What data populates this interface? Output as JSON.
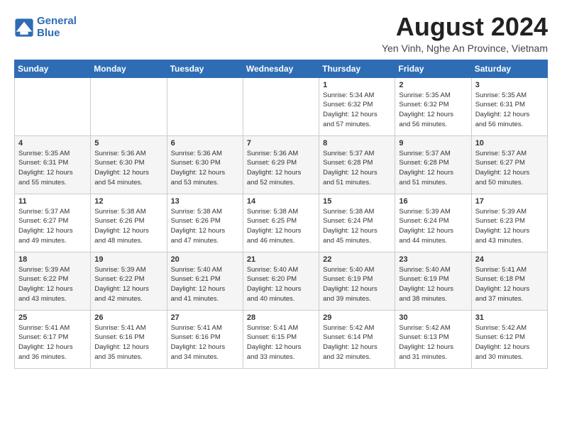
{
  "logo": {
    "line1": "General",
    "line2": "Blue"
  },
  "title": "August 2024",
  "subtitle": "Yen Vinh, Nghe An Province, Vietnam",
  "weekdays": [
    "Sunday",
    "Monday",
    "Tuesday",
    "Wednesday",
    "Thursday",
    "Friday",
    "Saturday"
  ],
  "weeks": [
    [
      {
        "day": "",
        "info": ""
      },
      {
        "day": "",
        "info": ""
      },
      {
        "day": "",
        "info": ""
      },
      {
        "day": "",
        "info": ""
      },
      {
        "day": "1",
        "info": "Sunrise: 5:34 AM\nSunset: 6:32 PM\nDaylight: 12 hours\nand 57 minutes."
      },
      {
        "day": "2",
        "info": "Sunrise: 5:35 AM\nSunset: 6:32 PM\nDaylight: 12 hours\nand 56 minutes."
      },
      {
        "day": "3",
        "info": "Sunrise: 5:35 AM\nSunset: 6:31 PM\nDaylight: 12 hours\nand 56 minutes."
      }
    ],
    [
      {
        "day": "4",
        "info": "Sunrise: 5:35 AM\nSunset: 6:31 PM\nDaylight: 12 hours\nand 55 minutes."
      },
      {
        "day": "5",
        "info": "Sunrise: 5:36 AM\nSunset: 6:30 PM\nDaylight: 12 hours\nand 54 minutes."
      },
      {
        "day": "6",
        "info": "Sunrise: 5:36 AM\nSunset: 6:30 PM\nDaylight: 12 hours\nand 53 minutes."
      },
      {
        "day": "7",
        "info": "Sunrise: 5:36 AM\nSunset: 6:29 PM\nDaylight: 12 hours\nand 52 minutes."
      },
      {
        "day": "8",
        "info": "Sunrise: 5:37 AM\nSunset: 6:28 PM\nDaylight: 12 hours\nand 51 minutes."
      },
      {
        "day": "9",
        "info": "Sunrise: 5:37 AM\nSunset: 6:28 PM\nDaylight: 12 hours\nand 51 minutes."
      },
      {
        "day": "10",
        "info": "Sunrise: 5:37 AM\nSunset: 6:27 PM\nDaylight: 12 hours\nand 50 minutes."
      }
    ],
    [
      {
        "day": "11",
        "info": "Sunrise: 5:37 AM\nSunset: 6:27 PM\nDaylight: 12 hours\nand 49 minutes."
      },
      {
        "day": "12",
        "info": "Sunrise: 5:38 AM\nSunset: 6:26 PM\nDaylight: 12 hours\nand 48 minutes."
      },
      {
        "day": "13",
        "info": "Sunrise: 5:38 AM\nSunset: 6:26 PM\nDaylight: 12 hours\nand 47 minutes."
      },
      {
        "day": "14",
        "info": "Sunrise: 5:38 AM\nSunset: 6:25 PM\nDaylight: 12 hours\nand 46 minutes."
      },
      {
        "day": "15",
        "info": "Sunrise: 5:38 AM\nSunset: 6:24 PM\nDaylight: 12 hours\nand 45 minutes."
      },
      {
        "day": "16",
        "info": "Sunrise: 5:39 AM\nSunset: 6:24 PM\nDaylight: 12 hours\nand 44 minutes."
      },
      {
        "day": "17",
        "info": "Sunrise: 5:39 AM\nSunset: 6:23 PM\nDaylight: 12 hours\nand 43 minutes."
      }
    ],
    [
      {
        "day": "18",
        "info": "Sunrise: 5:39 AM\nSunset: 6:22 PM\nDaylight: 12 hours\nand 43 minutes."
      },
      {
        "day": "19",
        "info": "Sunrise: 5:39 AM\nSunset: 6:22 PM\nDaylight: 12 hours\nand 42 minutes."
      },
      {
        "day": "20",
        "info": "Sunrise: 5:40 AM\nSunset: 6:21 PM\nDaylight: 12 hours\nand 41 minutes."
      },
      {
        "day": "21",
        "info": "Sunrise: 5:40 AM\nSunset: 6:20 PM\nDaylight: 12 hours\nand 40 minutes."
      },
      {
        "day": "22",
        "info": "Sunrise: 5:40 AM\nSunset: 6:19 PM\nDaylight: 12 hours\nand 39 minutes."
      },
      {
        "day": "23",
        "info": "Sunrise: 5:40 AM\nSunset: 6:19 PM\nDaylight: 12 hours\nand 38 minutes."
      },
      {
        "day": "24",
        "info": "Sunrise: 5:41 AM\nSunset: 6:18 PM\nDaylight: 12 hours\nand 37 minutes."
      }
    ],
    [
      {
        "day": "25",
        "info": "Sunrise: 5:41 AM\nSunset: 6:17 PM\nDaylight: 12 hours\nand 36 minutes."
      },
      {
        "day": "26",
        "info": "Sunrise: 5:41 AM\nSunset: 6:16 PM\nDaylight: 12 hours\nand 35 minutes."
      },
      {
        "day": "27",
        "info": "Sunrise: 5:41 AM\nSunset: 6:16 PM\nDaylight: 12 hours\nand 34 minutes."
      },
      {
        "day": "28",
        "info": "Sunrise: 5:41 AM\nSunset: 6:15 PM\nDaylight: 12 hours\nand 33 minutes."
      },
      {
        "day": "29",
        "info": "Sunrise: 5:42 AM\nSunset: 6:14 PM\nDaylight: 12 hours\nand 32 minutes."
      },
      {
        "day": "30",
        "info": "Sunrise: 5:42 AM\nSunset: 6:13 PM\nDaylight: 12 hours\nand 31 minutes."
      },
      {
        "day": "31",
        "info": "Sunrise: 5:42 AM\nSunset: 6:12 PM\nDaylight: 12 hours\nand 30 minutes."
      }
    ]
  ]
}
